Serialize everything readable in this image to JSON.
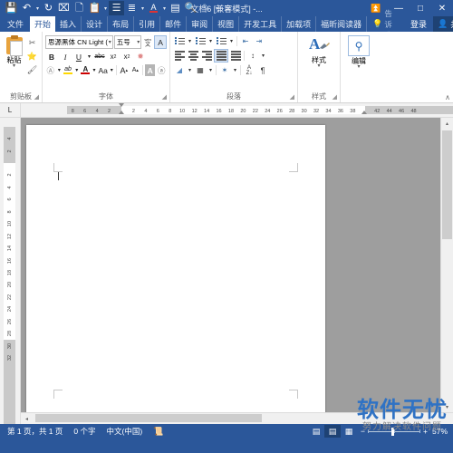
{
  "app": {
    "accent": "#2b579a",
    "accent_dark": "#1e4274",
    "title": "文档6 [兼容模式] -..."
  },
  "quick_access": {
    "buttons": [
      {
        "name": "save-icon",
        "glyph": "⬜",
        "state": "normal"
      },
      {
        "name": "undo-icon",
        "glyph": "↶",
        "state": "normal",
        "caret": true
      },
      {
        "name": "redo-icon",
        "glyph": "↻",
        "state": "normal"
      },
      {
        "name": "print-preview-icon",
        "glyph": "⌕",
        "state": "normal"
      },
      {
        "name": "new-document-icon",
        "glyph": "⬜",
        "state": "normal"
      },
      {
        "name": "paste-icon",
        "glyph": "⎘",
        "state": "normal",
        "caret": true
      },
      {
        "name": "read-mode-icon",
        "glyph": "☰",
        "state": "selected"
      },
      {
        "name": "paragraph-mark-icon",
        "glyph": "¶",
        "state": "normal",
        "caret": true
      },
      {
        "name": "font-color-icon",
        "glyph": "A",
        "state": "normal",
        "caret": true
      },
      {
        "name": "columns-icon",
        "glyph": "‖",
        "state": "normal"
      },
      {
        "name": "find-icon",
        "glyph": "⚲",
        "state": "normal"
      },
      {
        "name": "edit-icon",
        "glyph": "✎",
        "state": "dim",
        "caret": true
      },
      {
        "name": "customize-qat-icon",
        "glyph": "≡",
        "state": "normal"
      }
    ]
  },
  "window_controls": {
    "ribbon_display": "⬒",
    "minimize": "—",
    "maximize": "⬜",
    "close": "✕"
  },
  "tabs": [
    {
      "label": "文件",
      "active": false,
      "file": true
    },
    {
      "label": "开始",
      "active": true
    },
    {
      "label": "插入",
      "active": false
    },
    {
      "label": "设计",
      "active": false
    },
    {
      "label": "布局",
      "active": false
    },
    {
      "label": "引用",
      "active": false
    },
    {
      "label": "邮件",
      "active": false
    },
    {
      "label": "审阅",
      "active": false
    },
    {
      "label": "视图",
      "active": false
    },
    {
      "label": "开发工具",
      "active": false
    },
    {
      "label": "加载项",
      "active": false
    },
    {
      "label": "福昕阅读器",
      "active": false
    }
  ],
  "tab_right": {
    "tell_me": "告诉我...",
    "tell_me_icon": "💡",
    "sign_in": "登录",
    "share": "共享",
    "share_icon": "⚲"
  },
  "ribbon": {
    "groups": [
      {
        "label": "剪贴板",
        "dialog_launcher": "◢"
      },
      {
        "label": "字体",
        "dialog_launcher": "◢"
      },
      {
        "label": "段落",
        "dialog_launcher": "◢"
      },
      {
        "label": "样式",
        "dialog_launcher": "◢"
      },
      {
        "label": "编辑",
        "dialog_launcher": ""
      }
    ],
    "clipboard": {
      "paste_label": "粘贴",
      "paste_caret": "▾",
      "cut_icon": "✂",
      "copy_icon": "❐",
      "format_painter_icon": "🖌"
    },
    "font": {
      "font_name": "思源黑体 CN Light (中文",
      "font_size": "五号",
      "caret": "▾",
      "bold": "B",
      "italic": "I",
      "underline": "U",
      "strikethrough": "abc",
      "subscript": "x₂",
      "superscript": "x²",
      "clear_format_icon": "⬚",
      "text_effects_icon": "A",
      "highlight_icon": "ab",
      "font_color_icon": "A",
      "change_case_icon": "Aa",
      "phonetic_icon": "文",
      "enclose_char_icon": "A",
      "grow_font": "A",
      "shrink_font": "A",
      "char_border_icon": "A",
      "char_shading_icon": "ⓐ"
    },
    "paragraph": {
      "bullets_icon": "☰",
      "numbering_icon": "☰",
      "multilevel_icon": "☰",
      "decrease_indent_icon": "⇤",
      "increase_indent_icon": "⇥",
      "align_left_icon": "≡",
      "align_center_icon": "≡",
      "align_right_icon": "≡",
      "justify_icon": "≡",
      "distribute_icon": "≡",
      "line_spacing_icon": "↕",
      "shading_icon": "⬛",
      "borders_icon": "⊞",
      "sort_icon": "A↓",
      "show_marks_icon": "¶",
      "cn_layout_icon": "✵",
      "caret": "▾"
    },
    "styles": {
      "label": "样式",
      "caret": "▾",
      "icon_letter": "A"
    },
    "editing": {
      "label": "编辑",
      "caret": "▾",
      "icon": "⚲"
    },
    "collapse_ribbon_icon": "∧"
  },
  "ruler": {
    "tab_stop_marker": "L",
    "horizontal_left_numbers": [
      8,
      6,
      4,
      2
    ],
    "horizontal_numbers": [
      2,
      4,
      6,
      8,
      10,
      12,
      14,
      16,
      18,
      20,
      22,
      24,
      26,
      28,
      30,
      32,
      34,
      36,
      38
    ],
    "horizontal_right_numbers": [
      42,
      44,
      46,
      48
    ],
    "vertical_top_numbers": [
      4,
      2
    ],
    "vertical_numbers": [
      2,
      4,
      6,
      8,
      10,
      12,
      14,
      16,
      18,
      20,
      22,
      24,
      26,
      28
    ],
    "vertical_bottom_numbers": [
      30,
      32
    ]
  },
  "document": {
    "page_background": "#ffffff",
    "canvas_background": "#9e9e9e",
    "margin_marks": 4,
    "content": ""
  },
  "scrollbars": {
    "up_arrow": "▴",
    "down_arrow": "▾",
    "left_arrow": "◂",
    "right_arrow": "▸"
  },
  "status_bar": {
    "page_count": "第 1 页，共 1 页",
    "word_count": "0 个字",
    "language": "中文(中国)",
    "proofing_icon": "📖",
    "views": [
      {
        "name": "read-mode-view",
        "glyph": "☷",
        "selected": false
      },
      {
        "name": "print-layout-view",
        "glyph": "▤",
        "selected": true
      },
      {
        "name": "web-layout-view",
        "glyph": "⬚",
        "selected": false
      }
    ],
    "zoom_out": "−",
    "zoom_in": "+",
    "zoom_value": "57%"
  },
  "watermark": {
    "main": "软件无忧",
    "sub": "努力解决软件问题"
  }
}
